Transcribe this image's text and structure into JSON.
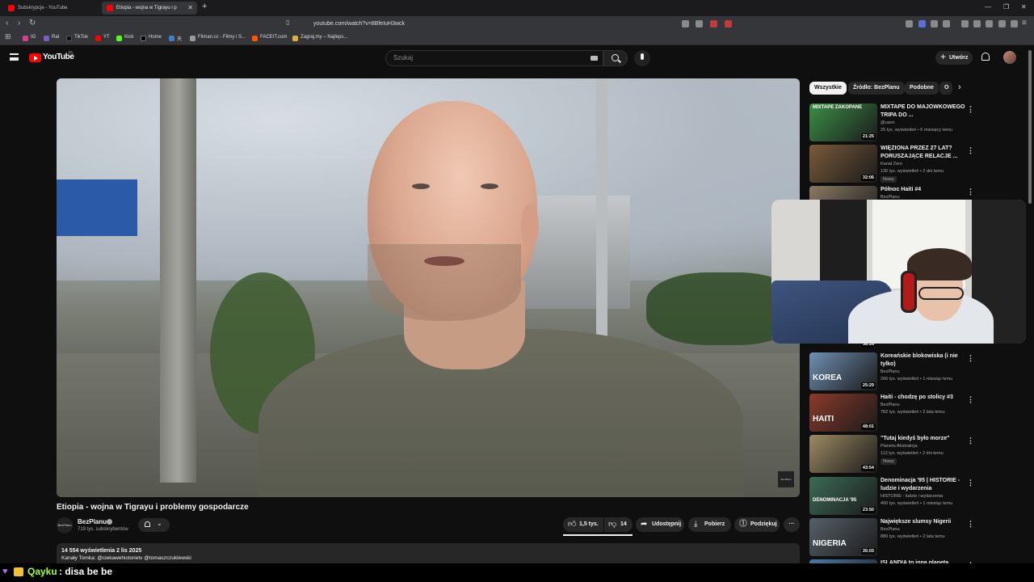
{
  "browser": {
    "tabs": [
      {
        "title": "Subskrypcje - YouTube"
      },
      {
        "title": "Etiopia - wojna w Tigrayu i p"
      }
    ],
    "url": "youtube.com/watch?v=8BfeIuH3wck",
    "bookmarks": [
      "IG",
      "Rat",
      "TikTok",
      "YT",
      "Kick",
      "Home",
      "天",
      "Filman.cc - Filmy i S...",
      "FACEIT.com",
      "Zagraj.my – Najleps..."
    ]
  },
  "youtube": {
    "logo": "YouTube",
    "country": "PL",
    "search_placeholder": "Szukaj",
    "create_label": "Utwórz"
  },
  "video": {
    "title": "Etiopia - wojna w Tigrayu i problemy gospodarcze",
    "watermark": "BezPlanu",
    "channel": {
      "name": "BezPlanu",
      "avatar_text": "BezPlanu",
      "subscribers": "719 tys. subskrybentów"
    },
    "likes": "1,5 tys.",
    "dislikes": "14",
    "share_label": "Udostępnij",
    "download_label": "Pobierz",
    "thanks_label": "Podziękuj",
    "description": {
      "stats": "14 554 wyświetlenia  2 lis 2025",
      "channels": "Kanały Tomka:  @ciekawehistorietv  @tomaszczuklewski"
    }
  },
  "sidebar": {
    "chips": [
      "Wszystkie",
      "Źródło: BezPlanu",
      "Podobne",
      "O"
    ],
    "recommendations": [
      {
        "title": "MIXTAPE DO MAJÓWKOWEGO TRIPA DO ...",
        "channel": "@usen",
        "meta": "25 tys. wyświetleń • 6 miesięcy temu",
        "duration": "21:25",
        "thumb_text": "MIXTAPE ZAKOPANE",
        "thumb_color": "#3b8f47"
      },
      {
        "title": "WIĘZIONA PRZEZ 27 LAT? PORUSZAJĄCE RELACJE ...",
        "channel": "Kanał Zero",
        "meta": "136 tys. wyświetleń • 2 dni temu",
        "badge": "Nowy",
        "duration": "32:06",
        "thumb_text": "",
        "thumb_color": "#7a5a3a"
      },
      {
        "title": "Północ Haiti #4",
        "channel": "BezPlanu",
        "meta": "",
        "duration": "",
        "thumb_text": "",
        "thumb_color": "#8a7a64"
      },
      {
        "title": "Koreańskie blokowiska (i nie tylko)",
        "channel": "BezPlanu",
        "meta": "266 tys. wyświetleń • 1 miesiąc temu",
        "duration": "25:29",
        "thumb_text": "KOREA",
        "thumb_color": "#6f8fb3"
      },
      {
        "title": "Haiti - chodzę po stolicy #3",
        "channel": "BezPlanu",
        "meta": "782 tys. wyświetleń • 2 lata temu",
        "duration": "48:01",
        "thumb_text": "HAITI",
        "thumb_color": "#8b3a2a"
      },
      {
        "title": "\"Tutaj kiedyś było morze\"",
        "channel": "Planeta Abstrakcja",
        "meta": "112 tys. wyświetleń • 2 dni temu",
        "badge": "Nowy",
        "duration": "43:54",
        "thumb_text": "",
        "thumb_color": "#9c8a63"
      },
      {
        "title": "Denominacja '95 | HISTORIE - ludzie i wydarzenia",
        "channel": "HISTORIE - ludzie i wydarzenia",
        "meta": "400 tys. wyświetleń • 1 miesiąc temu",
        "duration": "23:50",
        "thumb_text": "DENOMINACJA '95",
        "thumb_color": "#3c6b57"
      },
      {
        "title": "Największe slumsy Nigerii",
        "channel": "BezPlanu",
        "meta": "880 tys. wyświetleń • 2 lata temu",
        "duration": "35:03",
        "thumb_text": "NIGERIA",
        "thumb_color": "#55606a"
      },
      {
        "title": "ISLANDIA to inna planeta",
        "channel": "",
        "meta": "",
        "duration": "",
        "thumb_text": "",
        "thumb_color": "#4a7aa8"
      }
    ],
    "partial_duration": "38:26"
  },
  "chat": {
    "user": "Qayku",
    "message": ": disa be be"
  }
}
